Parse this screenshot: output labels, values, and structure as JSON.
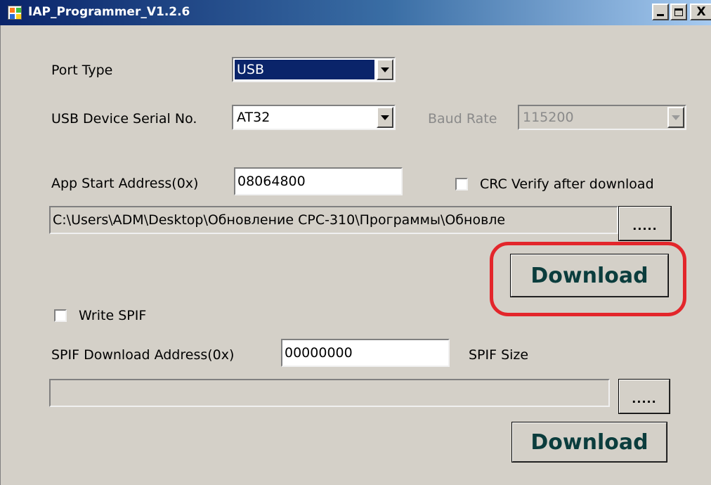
{
  "window": {
    "title": "IAP_Programmer_V1.2.6",
    "icon": "app-icon",
    "controls": {
      "minimize_icon": "minimize-icon",
      "maximize_icon": "maximize-icon",
      "close_glyph": "X"
    }
  },
  "port_type": {
    "label": "Port Type",
    "value": "USB"
  },
  "usb_serial": {
    "label": "USB Device Serial No.",
    "value": "AT32"
  },
  "baud_rate": {
    "label": "Baud Rate",
    "value": "115200",
    "enabled": false
  },
  "app_address": {
    "label": "App Start Address(0x)",
    "value": "08064800"
  },
  "crc_verify": {
    "label": "CRC Verify after download",
    "checked": false
  },
  "app_file": {
    "path": "C:\\Users\\ADM\\Desktop\\Обновление CPC-310\\Программы\\Обновле",
    "browse_label": "....."
  },
  "app_download": {
    "label": "Download",
    "highlight_color": "#e3262b"
  },
  "write_spif": {
    "label": "Write SPIF",
    "checked": false
  },
  "spif_address": {
    "label": "SPIF Download Address(0x)",
    "value": "00000000"
  },
  "spif_size": {
    "label": "SPIF Size"
  },
  "spif_file": {
    "path": "",
    "browse_label": "....."
  },
  "spif_download": {
    "label": "Download"
  },
  "colors": {
    "titlebar_start": "#0a246a",
    "titlebar_end": "#a6caf0",
    "window_bg": "#d4d0c8",
    "selection": "#0a246a",
    "download_text": "#0b3d3d"
  }
}
